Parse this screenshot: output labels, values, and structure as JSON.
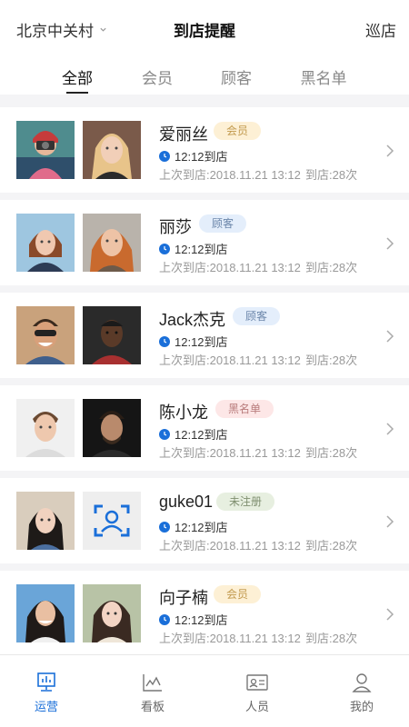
{
  "header": {
    "location": "北京中关村",
    "title": "到店提醒",
    "patrol": "巡店"
  },
  "tabs": [
    {
      "label": "全部",
      "active": true
    },
    {
      "label": "会员",
      "active": false
    },
    {
      "label": "顾客",
      "active": false
    },
    {
      "label": "黑名单",
      "active": false
    }
  ],
  "visits": [
    {
      "name": "爱丽丝",
      "tag": "会员",
      "time": "12:12到店",
      "last": "上次到店:2018.11.21   13:12",
      "count": "到店:28次"
    },
    {
      "name": "丽莎",
      "tag": "顾客",
      "time": "12:12到店",
      "last": "上次到店:2018.11.21   13:12",
      "count": "到店:28次"
    },
    {
      "name": "Jack杰克",
      "tag": "顾客",
      "time": "12:12到店",
      "last": "上次到店:2018.11.21   13:12",
      "count": "到店:28次"
    },
    {
      "name": "陈小龙",
      "tag": "黑名单",
      "time": "12:12到店",
      "last": "上次到店:2018.11.21   13:12",
      "count": "到店:28次"
    },
    {
      "name": "guke01",
      "tag": "未注册",
      "time": "12:12到店",
      "last": "上次到店:2018.11.21   13:12",
      "count": "到店:28次"
    },
    {
      "name": "向子楠",
      "tag": "会员",
      "time": "12:12到店",
      "last": "上次到店:2018.11.21   13:12",
      "count": "到店:28次"
    }
  ],
  "nav": [
    {
      "label": "运营",
      "icon": "operations-icon",
      "active": true
    },
    {
      "label": "看板",
      "icon": "dashboard-icon",
      "active": false
    },
    {
      "label": "人员",
      "icon": "staff-card-icon",
      "active": false
    },
    {
      "label": "我的",
      "icon": "profile-icon",
      "active": false
    }
  ],
  "colors": {
    "accent": "#1a6fd9",
    "member_badge": "#fdf0d5",
    "guest_badge": "#e4eefb",
    "black_badge": "#fde7e7",
    "unregistered_badge": "#e7efe0"
  }
}
